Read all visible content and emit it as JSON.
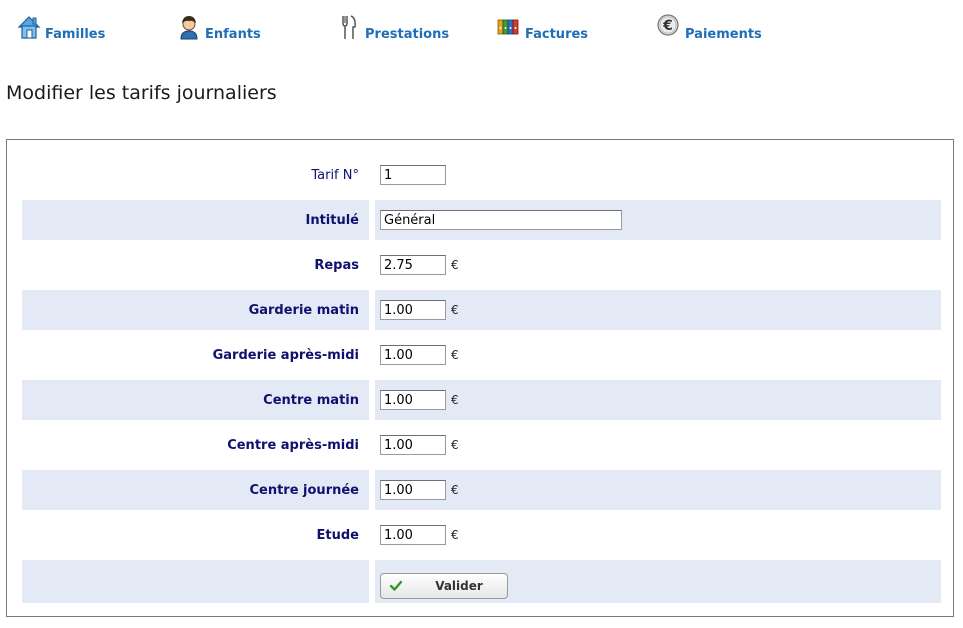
{
  "nav": {
    "items": [
      {
        "label": "Familles",
        "icon": "house-icon"
      },
      {
        "label": "Enfants",
        "icon": "child-icon"
      },
      {
        "label": "Prestations",
        "icon": "fork-knife-icon"
      },
      {
        "label": "Factures",
        "icon": "binders-icon"
      },
      {
        "label": "Paiements",
        "icon": "euro-coin-icon"
      }
    ]
  },
  "page": {
    "title": "Modifier les tarifs journaliers"
  },
  "form": {
    "currency": "€",
    "fields": [
      {
        "label": "Tarif N°",
        "value": "1"
      },
      {
        "label": "Intitulé",
        "value": "Général"
      },
      {
        "label": "Repas",
        "value": "2.75"
      },
      {
        "label": "Garderie matin",
        "value": "1.00"
      },
      {
        "label": "Garderie après-midi",
        "value": "1.00"
      },
      {
        "label": "Centre matin",
        "value": "1.00"
      },
      {
        "label": "Centre après-midi",
        "value": "1.00"
      },
      {
        "label": "Centre journée",
        "value": "1.00"
      },
      {
        "label": "Etude",
        "value": "1.00"
      }
    ],
    "submit_label": "Valider"
  },
  "colors": {
    "nav_link": "#1f6fb8",
    "form_label": "#10106e",
    "row_shade": "#e3eaf6",
    "panel_border": "#7a7a7a",
    "check_icon": "#2e9a2e"
  }
}
